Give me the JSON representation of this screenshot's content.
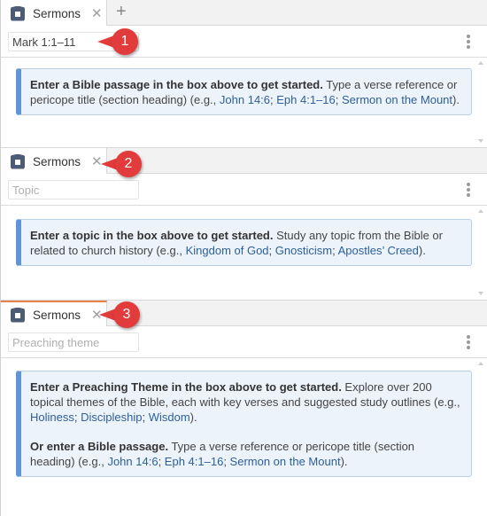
{
  "panels": [
    {
      "tab": {
        "label": "Sermons",
        "close": "✕",
        "add": "+"
      },
      "input": {
        "value": "Mark 1:1–11",
        "placeholder": ""
      },
      "info": {
        "bold": "Enter a Bible passage in the box above to get started.",
        "text": " Type a verse reference or pericope title (section heading) (e.g., ",
        "links": [
          "John 14:6",
          "Eph 4:1–16",
          "Sermon on the Mount"
        ],
        "sep": "; ",
        "end": ")."
      },
      "callout": "1"
    },
    {
      "tab": {
        "label": "Sermons",
        "close": "✕"
      },
      "input": {
        "value": "",
        "placeholder": "Topic"
      },
      "info": {
        "bold": "Enter a topic in the box above to get started.",
        "text": " Study any topic from the Bible or related to church history (e.g., ",
        "links": [
          "Kingdom of God",
          "Gnosticism",
          "Apostles’ Creed"
        ],
        "sep": "; ",
        "end": ")."
      },
      "callout": "2"
    },
    {
      "tab": {
        "label": "Sermons",
        "close": "✕"
      },
      "input": {
        "value": "",
        "placeholder": "Preaching theme"
      },
      "info": {
        "bold": "Enter a Preaching Theme in the box above to get started.",
        "text": " Explore over 200 topical themes of the Bible, each with key verses and suggested study outlines (e.g., ",
        "links": [
          "Holiness",
          "Discipleship",
          "Wisdom"
        ],
        "sep": "; ",
        "end": ").",
        "bold2": "Or enter a Bible passage.",
        "text2": " Type a verse reference or pericope title (section heading) (e.g., ",
        "links2": [
          "John 14:6",
          "Eph 4:1–16",
          "Sermon on the Mount"
        ],
        "end2": ")."
      },
      "callout": "3"
    }
  ],
  "colors": {
    "accent": "#5f95d6",
    "link": "#2d5f9a",
    "callout": "#e23b3b",
    "active_tab": "#e8824a"
  }
}
